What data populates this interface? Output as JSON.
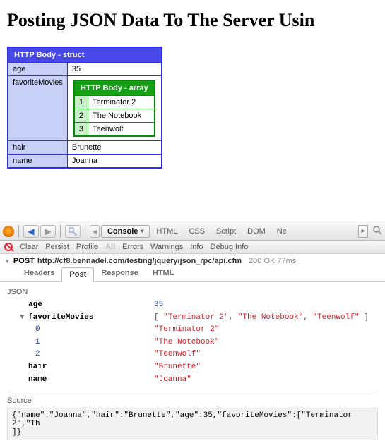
{
  "page": {
    "title": "Posting JSON Data To The Server Usin"
  },
  "dump": {
    "struct_header": "HTTP Body - struct",
    "array_header": "HTTP Body - array",
    "rows": {
      "age_key": "age",
      "age_val": "35",
      "fav_key": "favoriteMovies",
      "hair_key": "hair",
      "hair_val": "Brunette",
      "name_key": "name",
      "name_val": "Joanna"
    },
    "movies": [
      {
        "idx": "1",
        "val": "Terminator 2"
      },
      {
        "idx": "2",
        "val": "The Notebook"
      },
      {
        "idx": "3",
        "val": "Teenwolf"
      }
    ]
  },
  "firebug": {
    "console_label": "Console",
    "tabs": [
      "HTML",
      "CSS",
      "Script",
      "DOM",
      "Ne"
    ],
    "subbar": {
      "clear": "Clear",
      "persist": "Persist",
      "profile": "Profile",
      "all": "All",
      "errors": "Errors",
      "warnings": "Warnings",
      "info": "Info",
      "debug": "Debug Info"
    },
    "request": {
      "method": "POST",
      "url": "http://cf8.bennadel.com/testing/jquery/json_rpc/api.cfm",
      "status": "200 OK 77ms"
    },
    "tabs2": {
      "headers": "Headers",
      "post": "Post",
      "response": "Response",
      "html": "HTML"
    },
    "json_header": "JSON",
    "json": {
      "age_k": "age",
      "age_v": "35",
      "fav_k": "favoriteMovies",
      "fav_arr": "[ \"Terminator 2\", \"The Notebook\", \"Teenwolf\" ]",
      "i0": "0",
      "v0": "\"Terminator 2\"",
      "i1": "1",
      "v1": "\"The Notebook\"",
      "i2": "2",
      "v2": "\"Teenwolf\"",
      "hair_k": "hair",
      "hair_v": "\"Brunette\"",
      "name_k": "name",
      "name_v": "\"Joanna\""
    },
    "source_header": "Source",
    "source": "{\"name\":\"Joanna\",\"hair\":\"Brunette\",\"age\":35,\"favoriteMovies\":[\"Terminator 2\",\"Th\n]}"
  }
}
